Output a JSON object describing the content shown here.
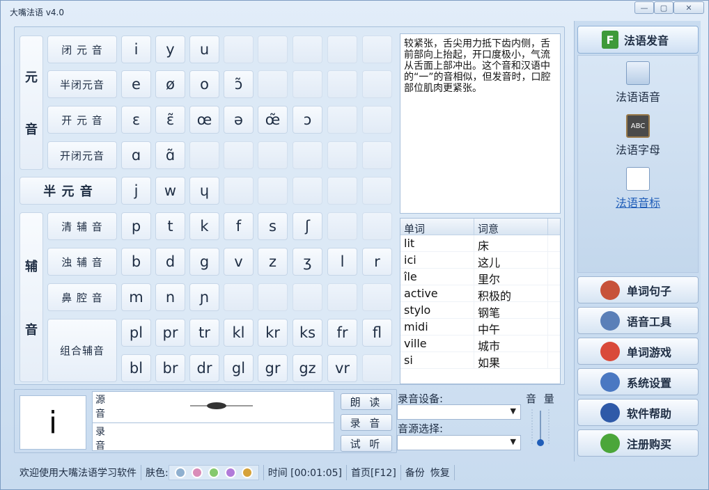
{
  "window": {
    "title": "大嘴法语 v4.0",
    "min": "—",
    "max": "▢",
    "close": "✕"
  },
  "groups": {
    "vowel": [
      "元",
      "音"
    ],
    "consonant": [
      "辅",
      "音"
    ],
    "semivowel": "半 元 音"
  },
  "rows": [
    {
      "label": "闭 元 音",
      "cells": [
        "i",
        "y",
        "u",
        "",
        "",
        "",
        "",
        ""
      ]
    },
    {
      "label": "半闭元音",
      "cells": [
        "e",
        "ø",
        "o",
        "ɔ̃",
        "",
        "",
        "",
        ""
      ]
    },
    {
      "label": "开 元 音",
      "cells": [
        "ɛ",
        "ɛ̃",
        "œ",
        "ə",
        "œ̃",
        "ɔ",
        "",
        ""
      ]
    },
    {
      "label": "开闭元音",
      "cells": [
        "ɑ",
        "ɑ̃",
        "",
        "",
        "",
        "",
        "",
        ""
      ]
    },
    {
      "label": "",
      "cells": [
        "j",
        "w",
        "ɥ",
        "",
        "",
        "",
        "",
        ""
      ]
    },
    {
      "label": "清 辅 音",
      "cells": [
        "p",
        "t",
        "k",
        "f",
        "s",
        "ʃ",
        "",
        ""
      ]
    },
    {
      "label": "浊 辅 音",
      "cells": [
        "b",
        "d",
        "g",
        "v",
        "z",
        "ʒ",
        "l",
        "r"
      ]
    },
    {
      "label": "鼻 腔 音",
      "cells": [
        "m",
        "n",
        "ɲ",
        "",
        "",
        "",
        "",
        ""
      ]
    },
    {
      "label": "组合辅音",
      "cells": [
        "pl",
        "pr",
        "tr",
        "kl",
        "kr",
        "ks",
        "fr",
        "fl"
      ]
    },
    {
      "label": "",
      "cells": [
        "bl",
        "br",
        "dr",
        "gl",
        "gr",
        "gz",
        "vr",
        ""
      ]
    }
  ],
  "description": "较紧张，舌尖用力抵下齿内侧，舌前部向上抬起，开口度极小，气流从舌面上部冲出。这个音和汉语中的“一”的音相似，但发音时，口腔部位肌肉更紧张。",
  "word_table": {
    "headers": [
      "单词",
      "词意"
    ],
    "rows": [
      [
        "lit",
        "床"
      ],
      [
        "ici",
        "这儿"
      ],
      [
        "île",
        "里尔"
      ],
      [
        "active",
        "积极的"
      ],
      [
        "stylo",
        "钢笔"
      ],
      [
        "midi",
        "中午"
      ],
      [
        "ville",
        "城市"
      ],
      [
        "si",
        "如果"
      ]
    ]
  },
  "current_symbol": "i",
  "wave_labels": {
    "source": "源\n音",
    "record": "录\n音"
  },
  "actions": {
    "read": "朗 读",
    "record": "录 音",
    "listen": "试 听"
  },
  "recording": {
    "device_label": "录音设备:",
    "source_label": "音源选择:",
    "volume_label": "音 量"
  },
  "sidebar": {
    "header": "法语发音",
    "nav": [
      "法语语音",
      "法语字母",
      "法语音标"
    ],
    "buttons": [
      "单词句子",
      "语音工具",
      "单词游戏",
      "系统设置",
      "软件帮助",
      "注册购买"
    ]
  },
  "status": {
    "welcome": "欢迎使用大嘴法语学习软件",
    "skin": "肤色:",
    "skin_colors": [
      "#8fb0cf",
      "#d98cb8",
      "#86c96e",
      "#b17ad9",
      "#d6a23a"
    ],
    "time": "时间 [00:01:05]",
    "home": "首页[F12]",
    "backup": "备份",
    "restore": "恢复"
  }
}
